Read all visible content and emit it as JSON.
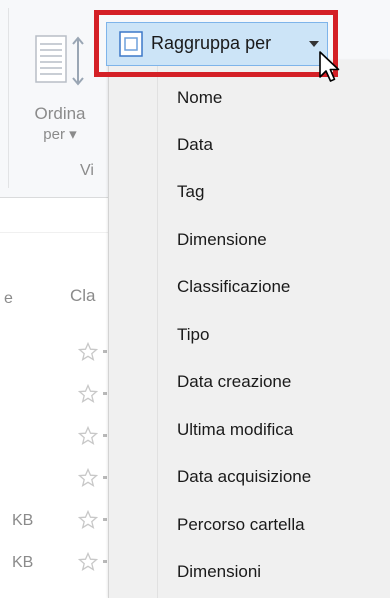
{
  "ribbon": {
    "ordina_label": "Ordina",
    "ordina_sub": "per ▾",
    "group_caption": "Vi"
  },
  "list": {
    "header_cut": "e",
    "header_rating": "Cla",
    "rows": [
      {
        "size": ""
      },
      {
        "size": ""
      },
      {
        "size": ""
      },
      {
        "size": ""
      },
      {
        "size": "KB"
      },
      {
        "size": "KB"
      }
    ]
  },
  "dropdown": {
    "label": "Raggruppa per",
    "icon": "group-by-icon",
    "highlight_color": "#d42026"
  },
  "menu": {
    "items": [
      "Nome",
      "Data",
      "Tag",
      "Dimensione",
      "Classificazione",
      "Tipo",
      "Data creazione",
      "Ultima modifica",
      "Data acquisizione",
      "Percorso cartella",
      "Dimensioni"
    ]
  }
}
